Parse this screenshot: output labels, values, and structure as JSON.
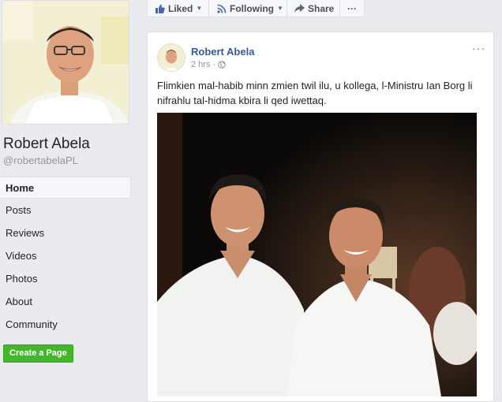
{
  "profile": {
    "name": "Robert Abela",
    "handle": "@robertabelaPL"
  },
  "nav": {
    "items": [
      "Home",
      "Posts",
      "Reviews",
      "Videos",
      "Photos",
      "About",
      "Community"
    ],
    "active": "Home"
  },
  "create_page_label": "Create a Page",
  "action_bar": {
    "liked_label": "Liked",
    "following_label": "Following",
    "share_label": "Share",
    "more_label": "···"
  },
  "post": {
    "author": "Robert Abela",
    "time": "2 hrs",
    "dot": "·",
    "text": "Flimkien mal-habib minn zmien twil ilu, u kollega, l-Ministru Ian Borg li nifrahlu tal-hidma kbira li qed iwettaq.",
    "more_label": "···"
  },
  "colors": {
    "link_blue": "#365899",
    "green_button": "#42b72a",
    "page_bg": "#e9ebee"
  }
}
